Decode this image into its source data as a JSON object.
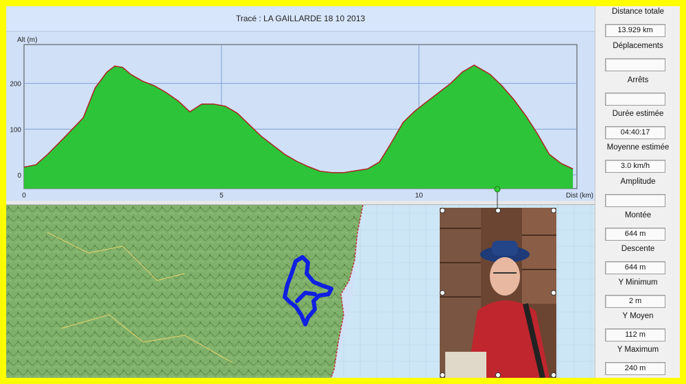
{
  "profile": {
    "title": "Tracé : LA GAILLARDE 18 10 2013"
  },
  "chart_data": {
    "type": "area",
    "ylabel": "Alt (m)",
    "xlabel": "Dist (km)",
    "xlim": [
      0,
      14
    ],
    "ylim": [
      -30,
      285
    ],
    "x_ticks": [
      0,
      5,
      10
    ],
    "y_ticks": [
      0,
      100,
      200
    ],
    "grid": true,
    "fill_color": "#2dc43a",
    "line_color": "#b02020",
    "x": [
      0,
      0.3,
      0.6,
      1.0,
      1.5,
      1.8,
      2.1,
      2.3,
      2.5,
      2.7,
      3.0,
      3.3,
      3.6,
      3.9,
      4.2,
      4.5,
      4.8,
      5.1,
      5.4,
      5.7,
      6.0,
      6.3,
      6.6,
      6.9,
      7.2,
      7.5,
      7.8,
      8.1,
      8.4,
      8.7,
      9.0,
      9.3,
      9.6,
      9.9,
      10.2,
      10.5,
      10.8,
      11.1,
      11.4,
      11.6,
      11.8,
      12.1,
      12.4,
      12.7,
      13.0,
      13.3,
      13.6,
      13.9
    ],
    "y": [
      17,
      22,
      45,
      80,
      125,
      190,
      225,
      238,
      235,
      220,
      205,
      195,
      180,
      162,
      138,
      155,
      155,
      150,
      135,
      110,
      85,
      65,
      45,
      30,
      18,
      8,
      5,
      5,
      9,
      13,
      28,
      70,
      115,
      140,
      160,
      180,
      200,
      225,
      240,
      230,
      220,
      195,
      165,
      130,
      90,
      45,
      25,
      13
    ],
    "series": [
      {
        "values": [
          17,
          22,
          45,
          80,
          125,
          190,
          225,
          238,
          235,
          220,
          205,
          195,
          180,
          162,
          138,
          155,
          155,
          150,
          135,
          110,
          85,
          65,
          45,
          30,
          18,
          8,
          5,
          5,
          9,
          13,
          28,
          70,
          115,
          140,
          160,
          180,
          200,
          225,
          240,
          230,
          220,
          195,
          165,
          130,
          90,
          45,
          25,
          13
        ]
      }
    ]
  },
  "stats": [
    {
      "label": "Distance totale",
      "value": "13.929 km"
    },
    {
      "label": "Déplacements",
      "value": ""
    },
    {
      "label": "Arrêts",
      "value": ""
    },
    {
      "label": "Durée estimée",
      "value": "04:40:17"
    },
    {
      "label": "Moyenne estimée",
      "value": "3.0 km/h"
    },
    {
      "label": "Amplitude",
      "value": ""
    },
    {
      "label": "Montée",
      "value": "644 m"
    },
    {
      "label": "Descente",
      "value": "644 m"
    },
    {
      "label": "Y Minimum",
      "value": "2 m"
    },
    {
      "label": "Y Moyen",
      "value": "112 m"
    },
    {
      "label": "Y Maximum",
      "value": "240 m"
    }
  ],
  "colors": {
    "frame": "#ffff00",
    "track": "#1020e0",
    "sea": "#cde6f5",
    "land": "#7fb06a"
  }
}
